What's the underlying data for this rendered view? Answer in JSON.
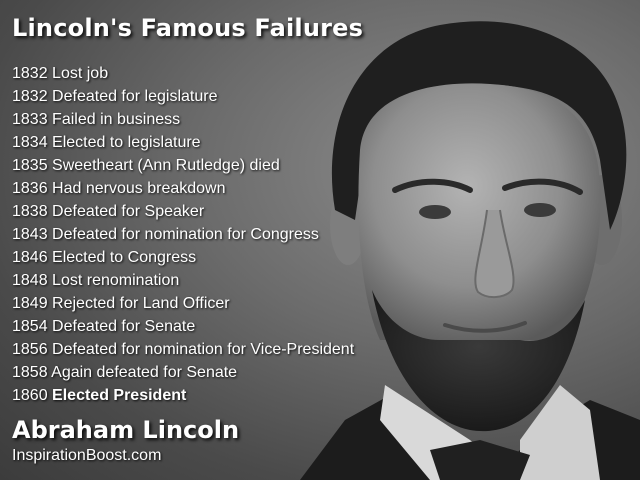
{
  "title": "Lincoln's Famous Failures",
  "timeline": [
    {
      "year": "1832",
      "event": "Lost job"
    },
    {
      "year": "1832",
      "event": "Defeated for legislature"
    },
    {
      "year": "1833",
      "event": "Failed in business"
    },
    {
      "year": "1834",
      "event": "Elected to legislature"
    },
    {
      "year": "1835",
      "event": "Sweetheart (Ann Rutledge) died"
    },
    {
      "year": "1836",
      "event": "Had nervous breakdown"
    },
    {
      "year": "1838",
      "event": "Defeated for Speaker"
    },
    {
      "year": "1843",
      "event": "Defeated for nomination for Congress"
    },
    {
      "year": "1846",
      "event": "Elected to Congress"
    },
    {
      "year": "1848",
      "event": "Lost renomination"
    },
    {
      "year": "1849",
      "event": "Rejected for Land Officer"
    },
    {
      "year": "1854",
      "event": "Defeated for Senate"
    },
    {
      "year": "1856",
      "event": "Defeated for nomination for Vice-President"
    },
    {
      "year": "1858",
      "event": "Again defeated for Senate"
    },
    {
      "year": "1860",
      "event": "Elected President"
    }
  ],
  "attribution": "Abraham Lincoln",
  "website": "InspirationBoost.com",
  "colors": {
    "text": "#ffffff",
    "background": "#6b6b6b"
  }
}
